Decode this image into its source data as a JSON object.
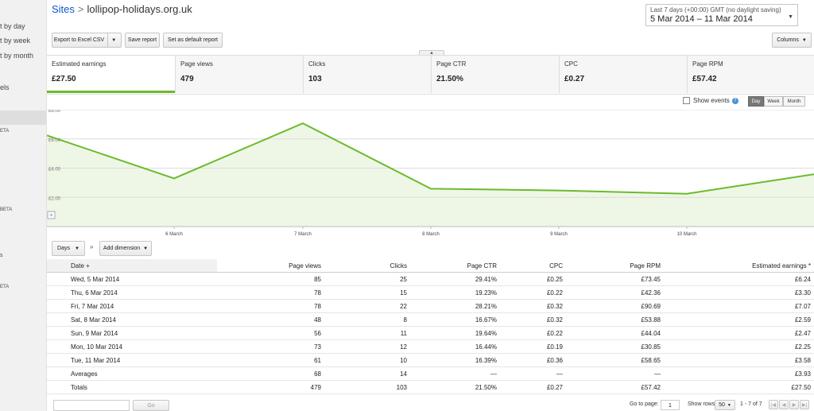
{
  "sidebar": {
    "items": [
      {
        "label": "t by day"
      },
      {
        "label": "t by week"
      },
      {
        "label": "t by month"
      },
      {
        "label": "els"
      },
      {
        "label": "ETA"
      },
      {
        "label": "BETA"
      },
      {
        "label": "s"
      },
      {
        "label": "ETA"
      }
    ]
  },
  "breadcrumb": {
    "root": "Sites",
    "separator": ">",
    "current": "lollipop-holidays.org.uk"
  },
  "date_range": {
    "line1": "Last 7 days (+00:00) GMT (no daylight saving)",
    "line2": "5 Mar 2014 – 11 Mar 2014"
  },
  "toolbar": {
    "export_label": "Export to Excel CSV",
    "save_label": "Save report",
    "default_label": "Set as default report",
    "columns_label": "Columns"
  },
  "metrics": [
    {
      "label": "Estimated earnings",
      "value": "£27.50"
    },
    {
      "label": "Page views",
      "value": "479"
    },
    {
      "label": "Clicks",
      "value": "103"
    },
    {
      "label": "Page CTR",
      "value": "21.50%"
    },
    {
      "label": "CPC",
      "value": "£0.27"
    },
    {
      "label": "Page RPM",
      "value": "£57.42"
    }
  ],
  "controls": {
    "show_events": "Show events",
    "help": "?",
    "day": "Day",
    "week": "Week",
    "month": "Month",
    "zoom": "+"
  },
  "colors": {
    "accent": "#6cba2c",
    "fill": "#eef7e6",
    "link": "#1155cc"
  },
  "chart_data": {
    "type": "area",
    "x": [
      "5 March",
      "6 March",
      "7 March",
      "8 March",
      "9 March",
      "10 March",
      "11 March"
    ],
    "xticks": [
      "6 March",
      "7 March",
      "8 March",
      "9 March",
      "10 March"
    ],
    "values": [
      6.24,
      3.3,
      7.07,
      2.59,
      2.47,
      2.25,
      3.58
    ],
    "yticks": [
      "£2.00",
      "£4.00",
      "£6.00",
      "£8.00"
    ],
    "yvals": [
      2,
      4,
      6,
      8
    ],
    "ylim": [
      0,
      8
    ],
    "grid": true
  },
  "dimension": {
    "days_label": "Days",
    "add_label": "Add dimension"
  },
  "table": {
    "headers": [
      "Date",
      "Page views",
      "Clicks",
      "Page CTR",
      "CPC",
      "Page RPM",
      "Estimated earnings"
    ],
    "sort_marker": "+",
    "sort_star": "*",
    "rows": [
      [
        "Wed, 5 Mar 2014",
        "85",
        "25",
        "29.41%",
        "£0.25",
        "£73.45",
        "£6.24"
      ],
      [
        "Thu, 6 Mar 2014",
        "78",
        "15",
        "19.23%",
        "£0.22",
        "£42.36",
        "£3.30"
      ],
      [
        "Fri, 7 Mar 2014",
        "78",
        "22",
        "28.21%",
        "£0.32",
        "£90.69",
        "£7.07"
      ],
      [
        "Sat, 8 Mar 2014",
        "48",
        "8",
        "16.67%",
        "£0.32",
        "£53.88",
        "£2.59"
      ],
      [
        "Sun, 9 Mar 2014",
        "56",
        "11",
        "19.64%",
        "£0.22",
        "£44.04",
        "£2.47"
      ],
      [
        "Mon, 10 Mar 2014",
        "73",
        "12",
        "16.44%",
        "£0.19",
        "£30.85",
        "£2.25"
      ],
      [
        "Tue, 11 Mar 2014",
        "61",
        "10",
        "16.39%",
        "£0.36",
        "£58.65",
        "£3.58"
      ]
    ],
    "averages": [
      "Averages",
      "68",
      "14",
      "—",
      "—",
      "—",
      "£3.93"
    ],
    "totals": [
      "Totals",
      "479",
      "103",
      "21.50%",
      "£0.27",
      "£57.42",
      "£27.50"
    ]
  },
  "footer": {
    "go_label": "Go",
    "goto_label": "Go to page:",
    "goto_value": "1",
    "show_rows_label": "Show rows:",
    "show_rows_value": "50",
    "range_label": "1 - 7 of 7"
  }
}
